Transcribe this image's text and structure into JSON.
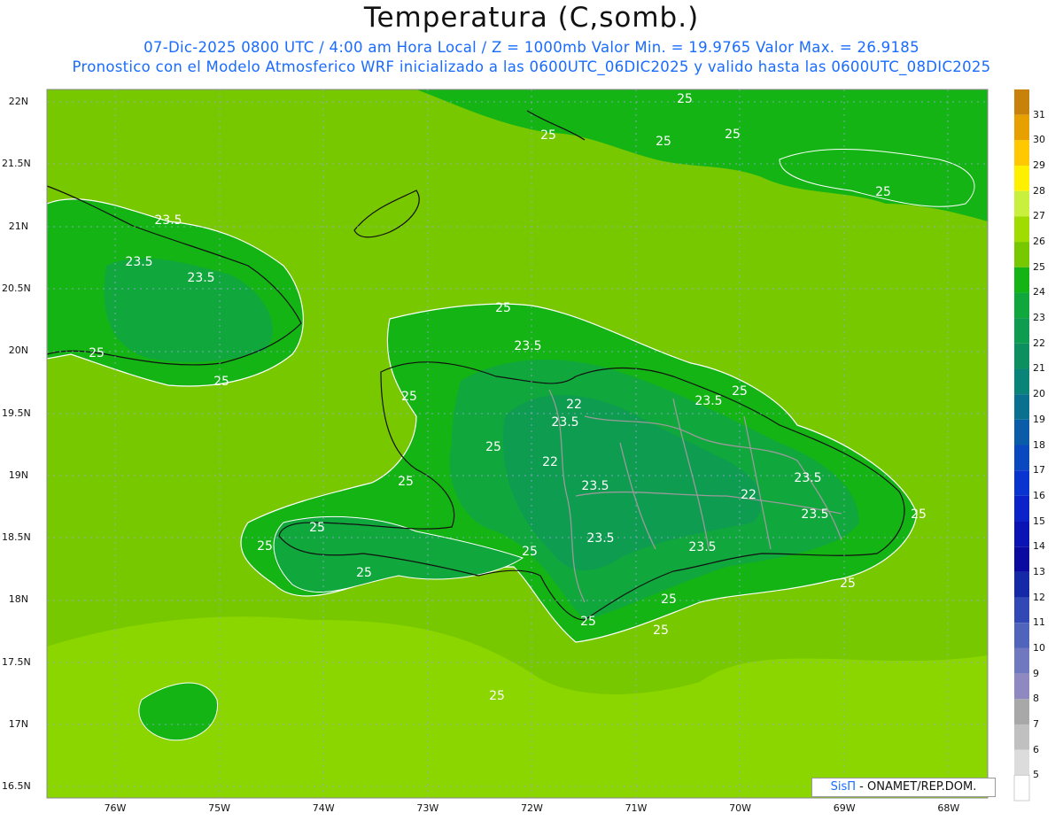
{
  "header": {
    "title": "Temperatura (C,somb.)",
    "line1": "07-Dic-2025  0800 UTC / 4:00 am Hora Local / Z = 1000mb   Valor Min. = 19.9765  Valor Max. = 26.9185",
    "line2": "Pronostico con el Modelo Atmosferico WRF inicializado a las 0600UTC_06DIC2025 y valido hasta las  0600UTC_08DIC2025"
  },
  "axes": {
    "lat_labels": [
      "22N",
      "21.5N",
      "21N",
      "20.5N",
      "20N",
      "19.5N",
      "19N",
      "18.5N",
      "18N",
      "17.5N",
      "17N",
      "16.5N"
    ],
    "lon_labels": [
      "76W",
      "75W",
      "74W",
      "73W",
      "72W",
      "71W",
      "70W",
      "69W",
      "68W"
    ]
  },
  "color_scale": {
    "labels": [
      "31",
      "30",
      "29",
      "28",
      "27",
      "26",
      "25",
      "24",
      "23",
      "22",
      "21",
      "20",
      "19",
      "18",
      "17",
      "16",
      "15",
      "14",
      "13",
      "12",
      "11",
      "10",
      "9",
      "8",
      "7",
      "6",
      "5"
    ],
    "colors": [
      "#c8820a",
      "#e6a000",
      "#ffc800",
      "#fff000",
      "#c8f03c",
      "#a0dc00",
      "#78c800",
      "#14b414",
      "#10a83c",
      "#0e9c50",
      "#0c9060",
      "#0a8478",
      "#0a7090",
      "#0a5ca8",
      "#0a48c0",
      "#0a34d0",
      "#0a22c8",
      "#0a14b4",
      "#0a0aa0",
      "#1428a8",
      "#3248b4",
      "#5064bc",
      "#7078c0",
      "#9088c0",
      "#a8a8a8",
      "#c0c0c0",
      "#dcdcdc"
    ]
  },
  "contour_labels": [
    "25",
    "25",
    "25",
    "25",
    "25",
    "23.5",
    "23.5",
    "23.5",
    "25",
    "25",
    "25",
    "23.5",
    "25",
    "25",
    "22",
    "23.5",
    "22",
    "25",
    "23.5",
    "22",
    "23.5",
    "23.5",
    "25",
    "25",
    "25",
    "25",
    "23.5",
    "23.5",
    "25",
    "25",
    "25",
    "23.5",
    "25",
    "25",
    "25",
    "25"
  ],
  "credit": {
    "brand": "SisΠ",
    "text": " - ONAMET/REP.DOM."
  }
}
